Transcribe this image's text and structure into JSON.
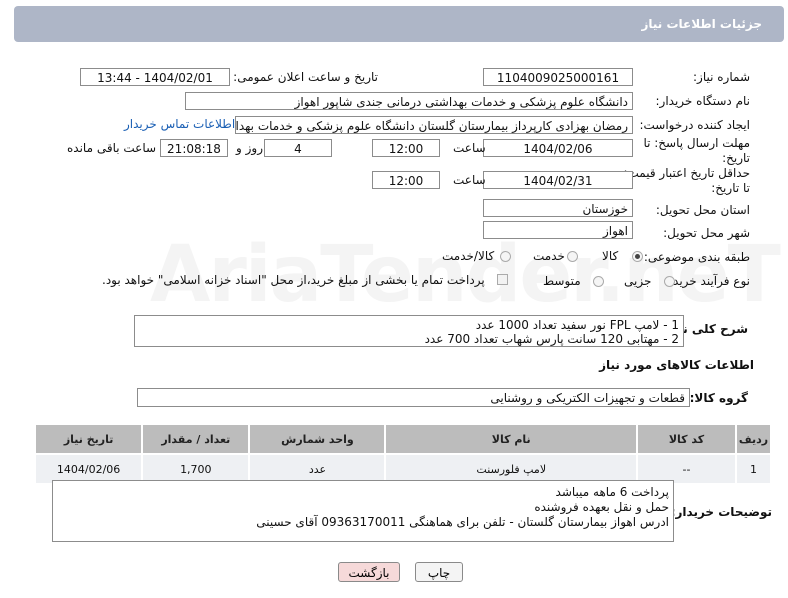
{
  "header": {
    "title": "جزئیات اطلاعات نیاز"
  },
  "fields": {
    "need_number_label": "شماره نیاز:",
    "need_number": "1104009025000161",
    "announce_label": "تاریخ و ساعت اعلان عمومی:",
    "announce_value": "1404/02/01 - 13:44",
    "buyer_org_label": "نام دستگاه خریدار:",
    "buyer_org": "دانشگاه علوم پزشکی و خدمات بهداشتی درمانی جندی شاپور اهواز",
    "requester_label": "ایجاد کننده درخواست:",
    "requester": "رمضان بهزادی کارپرداز بیمارستان گلستان دانشگاه علوم پزشکی و خدمات بهداشتی",
    "contact_link": "اطلاعات تماس خریدار",
    "deadline_label_1": "مهلت ارسال پاسخ: تا",
    "deadline_label_2": "تاریخ:",
    "deadline_date": "1404/02/06",
    "time_label": "ساعت",
    "deadline_time": "12:00",
    "days_value": "4",
    "days_label": "روز و",
    "remaining_time": "21:08:18",
    "remaining_label": "ساعت باقی مانده",
    "min_validity_label_1": "حداقل تاریخ اعتبار قیمت:",
    "min_validity_label_2": "تا تاریخ:",
    "validity_date": "1404/02/31",
    "validity_time_label": "ساعت",
    "validity_time": "12:00",
    "province_label": "استان محل تحویل:",
    "province": "خوزستان",
    "city_label": "شهر محل تحویل:",
    "city": "اهواز",
    "category_label": "طبقه بندی موضوعی:",
    "category_options": [
      "کالا",
      "خدمت",
      "کالا/خدمت"
    ],
    "process_label": "نوع فرآیند خرید :",
    "process_options": [
      "جزیی",
      "متوسط"
    ],
    "payment_note": "پرداخت تمام یا بخشی از مبلغ خرید،از محل \"اسناد خزانه اسلامی\" خواهد بود."
  },
  "description": {
    "label": "شرح کلی نیاز:",
    "text": "1 - لامپ FPL نور سفید تعداد 1000 عدد\n2 - مهتابی 120 سانت پارس شهاب تعداد 700 عدد"
  },
  "goods_info": {
    "title": "اطلاعات کالاهای مورد نیاز",
    "group_label": "گروه کالا:",
    "group_value": "قطعات و تجهیزات الکتریکی و روشنایی"
  },
  "table": {
    "headers": [
      "ردیف",
      "کد کالا",
      "نام کالا",
      "واحد شمارش",
      "تعداد / مقدار",
      "تاریخ نیاز"
    ],
    "rows": [
      [
        "1",
        "--",
        "لامپ فلورسنت",
        "عدد",
        "1,700",
        "1404/02/06"
      ]
    ]
  },
  "buyer_notes": {
    "label": "توضیحات خریدار:",
    "text": "پرداخت 6 ماهه میباشد\nحمل و نقل بعهده فروشنده\nادرس اهواز بیمارستان گلستان - تلفن برای هماهنگی 09363170011 آقای حسینی"
  },
  "buttons": {
    "print": "چاپ",
    "back": "بازگشت"
  },
  "watermark": "AriaTender.neT",
  "colors": {
    "header_bg": "#aeb6c7",
    "link": "#1a5fb4",
    "table_header": "#bcbcbc",
    "back_button_bg": "#f6d9d9"
  }
}
